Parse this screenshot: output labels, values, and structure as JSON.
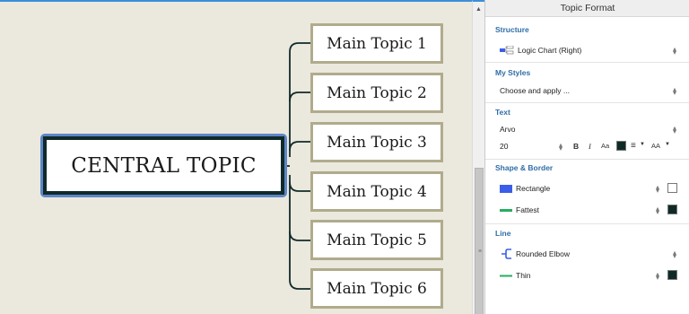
{
  "canvas": {
    "central_topic": "CENTRAL TOPIC",
    "main_topics": [
      "Main Topic 1",
      "Main Topic 2",
      "Main Topic 3",
      "Main Topic 4",
      "Main Topic 5",
      "Main Topic 6"
    ]
  },
  "panel": {
    "title": "Topic Format",
    "structure": {
      "title": "Structure",
      "value": "Logic Chart (Right)"
    },
    "my_styles": {
      "title": "My Styles",
      "value": "Choose and apply ..."
    },
    "text": {
      "title": "Text",
      "font": "Arvo",
      "size": "20",
      "bold_label": "B",
      "italic_label": "I",
      "case_label": "Aa",
      "font_color": "#0f2a26",
      "align_label": "≡",
      "size_adjust_label": "AA"
    },
    "shape_border": {
      "title": "Shape & Border",
      "shape": "Rectangle",
      "shape_color": "#3b5ee8",
      "shape_fill": "#ffffff",
      "border": "Fattest",
      "border_color": "#27ae60",
      "border_fill": "#0f2a26"
    },
    "line": {
      "title": "Line",
      "style": "Rounded Elbow",
      "style_color": "#3b5ee8",
      "weight": "Thin",
      "weight_color": "#27ae60",
      "line_fill": "#0f2a26"
    }
  },
  "colors": {
    "accent": "#3d8fd8",
    "canvas_bg": "#ebe8dd",
    "topic_border": "#b0ab8c",
    "central_border": "#102a2a"
  }
}
